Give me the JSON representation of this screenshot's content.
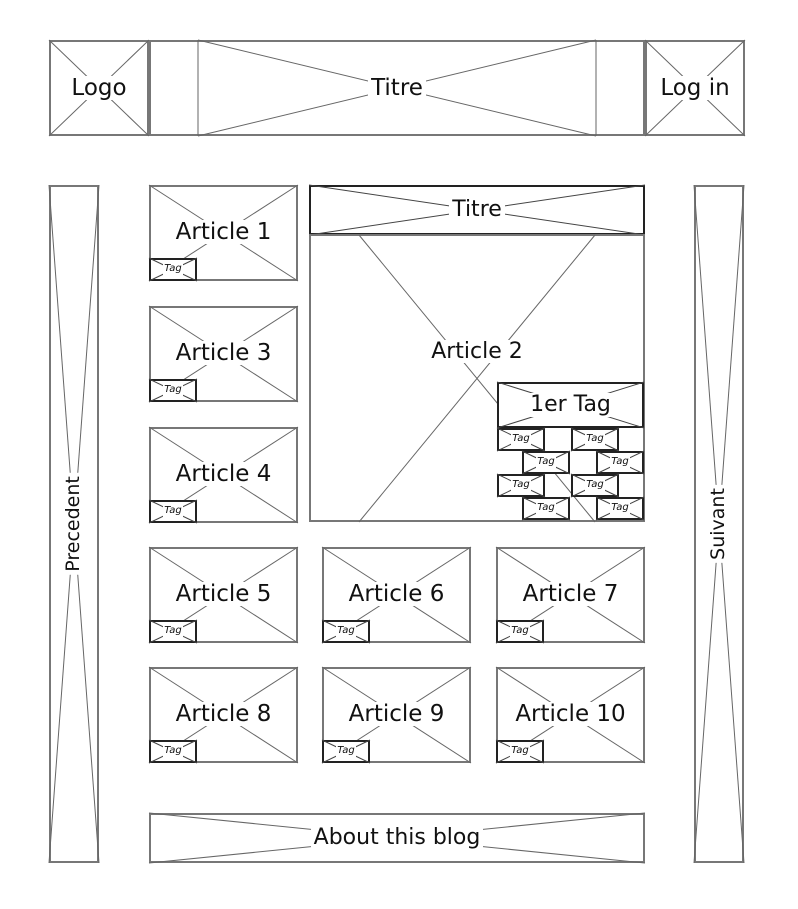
{
  "header": {
    "logo": "Logo",
    "title": "Titre",
    "login": "Log in"
  },
  "nav": {
    "previous": "Precedent",
    "next": "Suivant"
  },
  "featured": {
    "title": "Titre",
    "article": "Article 2",
    "first_tag": "1er Tag"
  },
  "tag_label": "Tag",
  "articles": [
    "Article 1",
    "Article 3",
    "Article 4",
    "Article 5",
    "Article 6",
    "Article 7",
    "Article 8",
    "Article 9",
    "Article 10"
  ],
  "footer": {
    "about": "About this blog"
  }
}
